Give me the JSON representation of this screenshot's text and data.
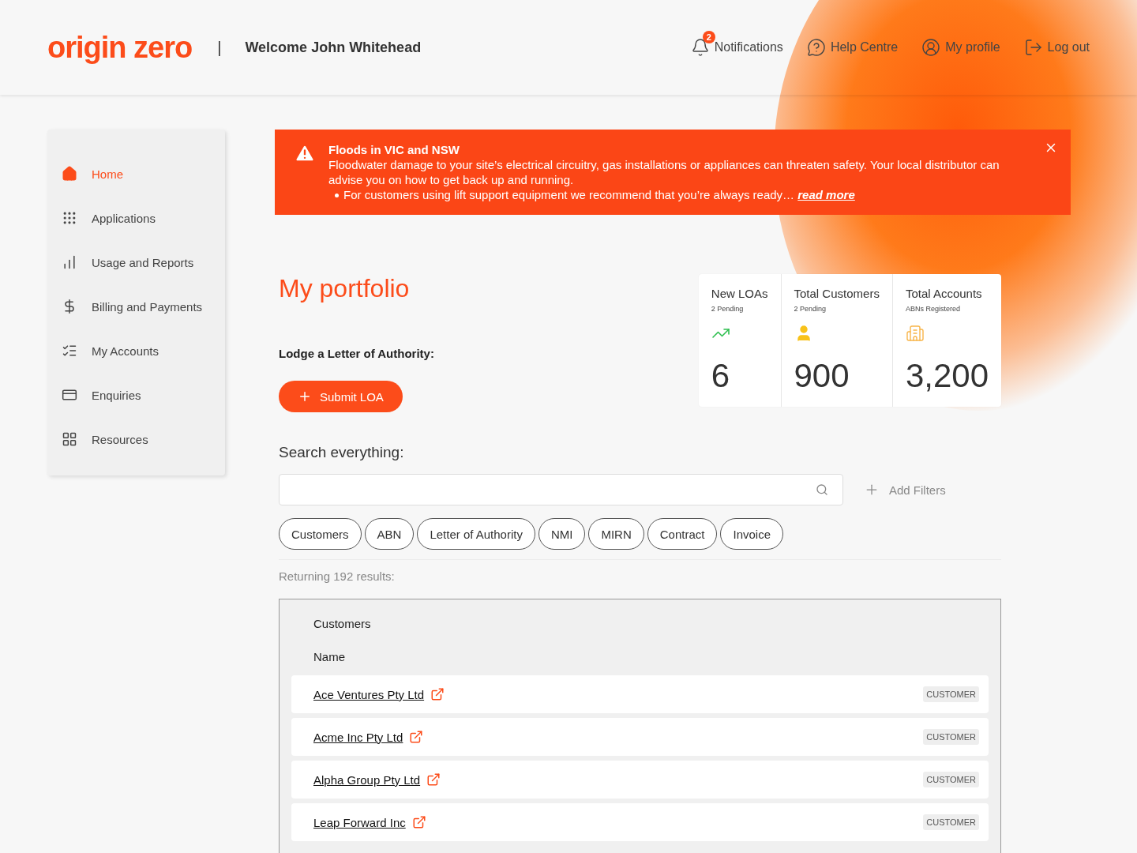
{
  "header": {
    "logo": "origin zero",
    "separator": "|",
    "welcome": "Welcome John Whitehead",
    "nav": [
      {
        "kind": "notifications",
        "label": "Notifications",
        "badge": "2"
      },
      {
        "kind": "help",
        "label": "Help Centre"
      },
      {
        "kind": "profile",
        "label": "My profile"
      },
      {
        "kind": "logout",
        "label": "Log out"
      }
    ]
  },
  "sidebar": {
    "items": [
      {
        "kind": "home",
        "label": "Home",
        "selected": true
      },
      {
        "kind": "applications",
        "label": "Applications",
        "selected": false
      },
      {
        "kind": "usage",
        "label": "Usage and Reports",
        "selected": false
      },
      {
        "kind": "billing",
        "label": "Billing and Payments",
        "selected": false
      },
      {
        "kind": "accounts",
        "label": "My Accounts",
        "selected": false
      },
      {
        "kind": "enquiries",
        "label": "Enquiries",
        "selected": false
      },
      {
        "kind": "resources",
        "label": "Resources",
        "selected": false
      }
    ]
  },
  "alert": {
    "title": "Floods in VIC and NSW",
    "body": "Floodwater damage to your site’s electrical circuitry, gas installations or appliances can threaten safety. Your local distributor can advise you on how to get back up and running.",
    "bullet": "For customers using lift support equipment we recommend that you’re always ready…",
    "link": "read more"
  },
  "portfolio": {
    "title": "My portfolio",
    "lodge_label": "Lodge a Letter of Authority:",
    "submit_button": "Submit LOA",
    "stats": [
      {
        "kind": "trend",
        "title": "New LOAs",
        "subtitle": "2 Pending",
        "value": "6"
      },
      {
        "kind": "person",
        "title": "Total Customers",
        "subtitle": "2 Pending",
        "value": "900"
      },
      {
        "kind": "building",
        "title": "Total Accounts",
        "subtitle": "ABNs Registered",
        "value": "3,200"
      }
    ]
  },
  "search": {
    "label": "Search everything:",
    "add_filters": "Add Filters",
    "chips": [
      "Customers",
      "ABN",
      "Letter of Authority",
      "NMI",
      "MIRN",
      "Contract",
      "Invoice"
    ],
    "results_text": "Returning 192 results:"
  },
  "results": {
    "heading": "Customers",
    "column": "Name",
    "rows": [
      {
        "name": "Ace Ventures Pty Ltd",
        "tag": "CUSTOMER"
      },
      {
        "name": "Acme Inc Pty Ltd",
        "tag": "CUSTOMER"
      },
      {
        "name": "Alpha Group Pty Ltd",
        "tag": "CUSTOMER"
      },
      {
        "name": "Leap Forward Inc",
        "tag": "CUSTOMER"
      }
    ]
  }
}
